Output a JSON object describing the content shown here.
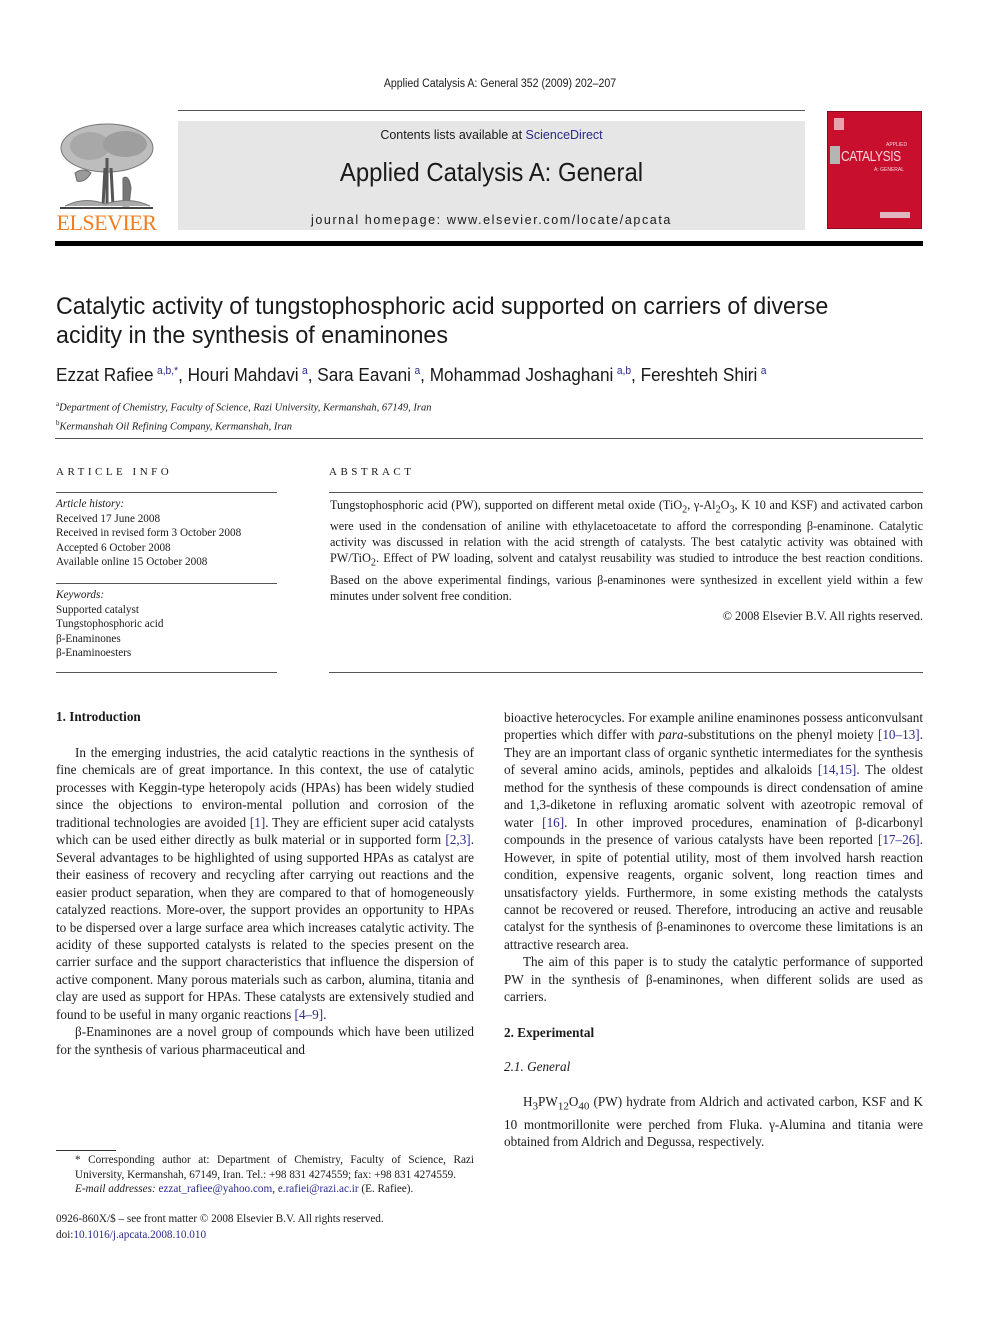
{
  "running_head": "Applied Catalysis A: General 352 (2009) 202–207",
  "masthead": {
    "contents_prefix": "Contents lists available at ",
    "contents_link": "ScienceDirect",
    "journal_title": "Applied Catalysis A: General",
    "homepage": "journal homepage: www.elsevier.com/locate/apcata",
    "publisher_logo_text": "ELSEVIER",
    "cover": {
      "top_text": "APPLIED",
      "title": "CATALYSIS",
      "sub_text": "A: GENERAL",
      "color": "#c8102e"
    }
  },
  "article": {
    "title": "Catalytic activity of tungstophosphoric acid supported on carriers of diverse acidity in the synthesis of enaminones",
    "authors": [
      {
        "name": "Ezzat Rafiee",
        "sup": "a,b,*"
      },
      {
        "name": "Houri Mahdavi",
        "sup": "a"
      },
      {
        "name": "Sara Eavani",
        "sup": "a"
      },
      {
        "name": "Mohammad Joshaghani",
        "sup": "a,b"
      },
      {
        "name": "Fereshteh Shiri",
        "sup": "a"
      }
    ],
    "affiliations": [
      {
        "key": "a",
        "text": "Department of Chemistry, Faculty of Science, Razi University, Kermanshah, 67149, Iran"
      },
      {
        "key": "b",
        "text": "Kermanshah Oil Refining Company, Kermanshah, Iran"
      }
    ]
  },
  "article_info": {
    "heading": "ARTICLE INFO",
    "history_label": "Article history:",
    "history": [
      "Received 17 June 2008",
      "Received in revised form 3 October 2008",
      "Accepted 6 October 2008",
      "Available online 15 October 2008"
    ],
    "keywords_label": "Keywords:",
    "keywords": [
      "Supported catalyst",
      "Tungstophosphoric acid",
      "β-Enaminones",
      "β-Enaminoesters"
    ]
  },
  "abstract": {
    "heading": "ABSTRACT",
    "text_parts": [
      "Tungstophosphoric acid (PW), supported on different metal oxide (TiO",
      "2",
      ", γ-Al",
      "2",
      "O",
      "3",
      ", K 10 and KSF) and activated carbon were used in the condensation of aniline with ethylacetoacetate to afford the corresponding β-enaminone. Catalytic activity was discussed in relation with the acid strength of catalysts. The best catalytic activity was obtained with PW/TiO",
      "2",
      ". Effect of PW loading, solvent and catalyst reusability was studied to introduce the best reaction conditions. Based on the above experimental findings, various β-enaminones were synthesized in excellent yield within a few minutes under solvent free condition."
    ],
    "copyright": "© 2008 Elsevier B.V. All rights reserved."
  },
  "body": {
    "section1_heading": "1.  Introduction",
    "intro_p1": [
      "In the emerging industries, the acid catalytic reactions in the synthesis of fine chemicals are of great importance. In this context, the use of catalytic processes with Keggin-type heteropoly acids (HPAs) has been widely studied since the objections to environ-mental pollution and corrosion of the traditional technologies are avoided ",
      "[1]",
      ". They are efficient super acid catalysts which can be used either directly as bulk material or in supported form ",
      "[2,3]",
      ". Several advantages to be highlighted of using supported HPAs as catalyst are their easiness of recovery and recycling after carrying out reactions and the easier product separation, when they are compared to that of homogeneously catalyzed reactions. More-over, the support provides an opportunity to HPAs to be dispersed over a large surface area which increases catalytic activity. The acidity of these supported catalysts is related to the species present on the carrier surface and the support characteristics that influence the dispersion of active component. Many porous materials such as carbon, alumina, titania and clay are used as support for HPAs. These catalysts are extensively studied and found to be useful in many organic reactions ",
      "[4–9]",
      "."
    ],
    "intro_p2_left": "β-Enaminones are a novel group of compounds which have been utilized for the synthesis of various pharmaceutical and",
    "intro_p2_right": [
      "bioactive heterocycles. For example aniline enaminones possess anticonvulsant properties which differ with ",
      "para",
      "-substitutions on the phenyl moiety ",
      "[10–13]",
      ". They are an important class of organic synthetic intermediates for the synthesis of several amino acids, aminols, peptides and alkaloids ",
      "[14,15]",
      ". The oldest method for the synthesis of these compounds is direct condensation of amine and 1,3-diketone in refluxing aromatic solvent with azeotropic removal of water ",
      "[16]",
      ". In other improved procedures, enamination of β-dicarbonyl compounds in the presence of various catalysts have been reported ",
      "[17–26]",
      ". However, in spite of potential utility, most of them involved harsh reaction condition, expensive reagents, organic solvent, long reaction times and unsatisfactory yields. Furthermore, in some existing methods the catalysts cannot be recovered or reused. Therefore, introducing an active and reusable catalyst for the synthesis of β-enaminones to overcome these limitations is an attractive research area."
    ],
    "intro_p3": "The aim of this paper is to study the catalytic performance of supported PW in the synthesis of β-enaminones, when different solids are used as carriers.",
    "section2_heading": "2.  Experimental",
    "subsection21_heading": "2.1.  General",
    "general_p": [
      "H",
      "3",
      "PW",
      "12",
      "O",
      "40",
      " (PW) hydrate from Aldrich and activated carbon, KSF and K 10 montmorillonite were perched from Fluka. γ-Alumina and titania were obtained from Aldrich and Degussa, respectively."
    ]
  },
  "footnote": {
    "marker": "*",
    "corresponding": " Corresponding author at: Department of Chemistry, Faculty of Science, Razi University, Kermanshah, 67149, Iran. Tel.: +98 831 4274559; fax: +98 831 4274559.",
    "email_label": "E-mail addresses: ",
    "email1": "ezzat_rafiee@yahoo.com",
    "email_sep": ", ",
    "email2": "e.rafiei@razi.ac.ir",
    "email_suffix": " (E. Rafiee)."
  },
  "front_matter": {
    "issn_line": "0926-860X/$ – see front matter © 2008 Elsevier B.V. All rights reserved.",
    "doi_prefix": "doi:",
    "doi": "10.1016/j.apcata.2008.10.010"
  },
  "colors": {
    "link": "#2a2a8c",
    "elsevier_orange": "#f07e20",
    "masthead_bg": "#e6e6e6",
    "cover_red": "#c8102e"
  }
}
